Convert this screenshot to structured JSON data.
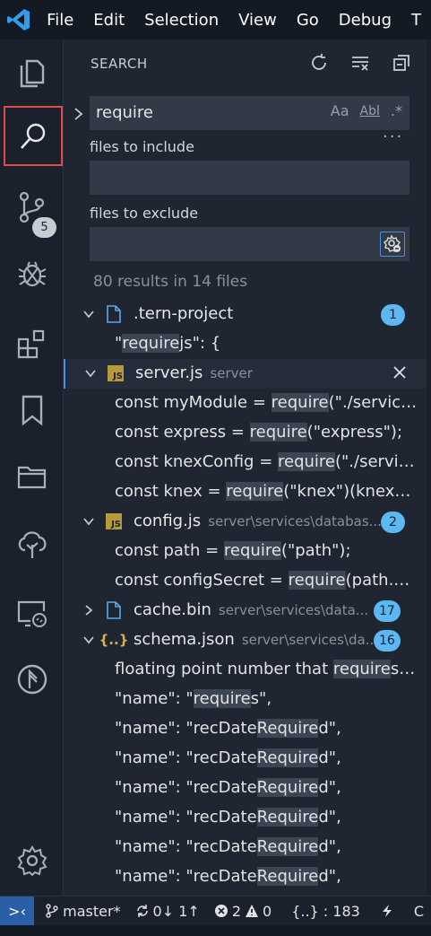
{
  "menu": [
    "File",
    "Edit",
    "Selection",
    "View",
    "Go",
    "Debug",
    "T"
  ],
  "activity": {
    "scm_badge": "5"
  },
  "sidebar": {
    "title": "SEARCH",
    "search_value": "require",
    "opt_case": "Aa",
    "opt_word": "Abl",
    "opt_regex": ".*",
    "include_label": "files to include",
    "exclude_label": "files to exclude",
    "summary": "80 results in 14 files"
  },
  "results": [
    {
      "kind": "file",
      "name": ".tern-project",
      "path": "",
      "count": "1",
      "icon": "file-icon"
    },
    {
      "kind": "match",
      "pre": "\"",
      "hit": "require",
      "post": "js\": {"
    },
    {
      "kind": "file",
      "name": "server.js",
      "path": "server",
      "count": "",
      "icon": "js-icon"
    },
    {
      "kind": "match",
      "pre": "const myModule = ",
      "hit": "require",
      "post": "(\"./services/..."
    },
    {
      "kind": "match",
      "pre": "const express = ",
      "hit": "require",
      "post": "(\"express\");"
    },
    {
      "kind": "match",
      "pre": "const knexConfig = ",
      "hit": "require",
      "post": "(\"./services/..."
    },
    {
      "kind": "match",
      "pre": "const knex = ",
      "hit": "require",
      "post": "(\"knex\")(knexCon..."
    },
    {
      "kind": "file",
      "name": "config.js",
      "path": "server\\services\\databas...",
      "count": "2",
      "icon": "js-icon"
    },
    {
      "kind": "match",
      "pre": "const path = ",
      "hit": "require",
      "post": "(\"path\");"
    },
    {
      "kind": "match",
      "pre": "const configSecret = ",
      "hit": "require",
      "post": "(path.nor..."
    },
    {
      "kind": "file",
      "name": "cache.bin",
      "path": "server\\services\\data...",
      "count": "17",
      "icon": "file-icon"
    },
    {
      "kind": "file",
      "name": "schema.json",
      "path": "server\\services\\da...",
      "count": "16",
      "icon": "json-icon"
    },
    {
      "kind": "match",
      "pre": "floating point number that ",
      "hit": "require",
      "post": "s m..."
    },
    {
      "kind": "match",
      "pre": "\"name\": \"",
      "hit": "require",
      "post": "s\","
    },
    {
      "kind": "match",
      "pre": "\"name\": \"recDate",
      "hit": "Require",
      "post": "d\","
    },
    {
      "kind": "match",
      "pre": "\"name\": \"recDate",
      "hit": "Require",
      "post": "d\","
    },
    {
      "kind": "match",
      "pre": "\"name\": \"recDate",
      "hit": "Require",
      "post": "d\","
    },
    {
      "kind": "match",
      "pre": "\"name\": \"recDate",
      "hit": "Require",
      "post": "d\","
    },
    {
      "kind": "match",
      "pre": "\"name\": \"recDate",
      "hit": "Require",
      "post": "d\","
    },
    {
      "kind": "match",
      "pre": "\"name\": \"recDate",
      "hit": "Require",
      "post": "d\","
    }
  ],
  "status": {
    "remote": ">‹",
    "branch": "master*",
    "sync": "0↓ 1↑",
    "errors": "2",
    "warnings": "0",
    "json": "{..} : 183",
    "extra": "C"
  },
  "colors": {
    "accent": "#5cb8f0",
    "selected_border": "#4d8ee8",
    "active_outline": "#e04a4a"
  }
}
